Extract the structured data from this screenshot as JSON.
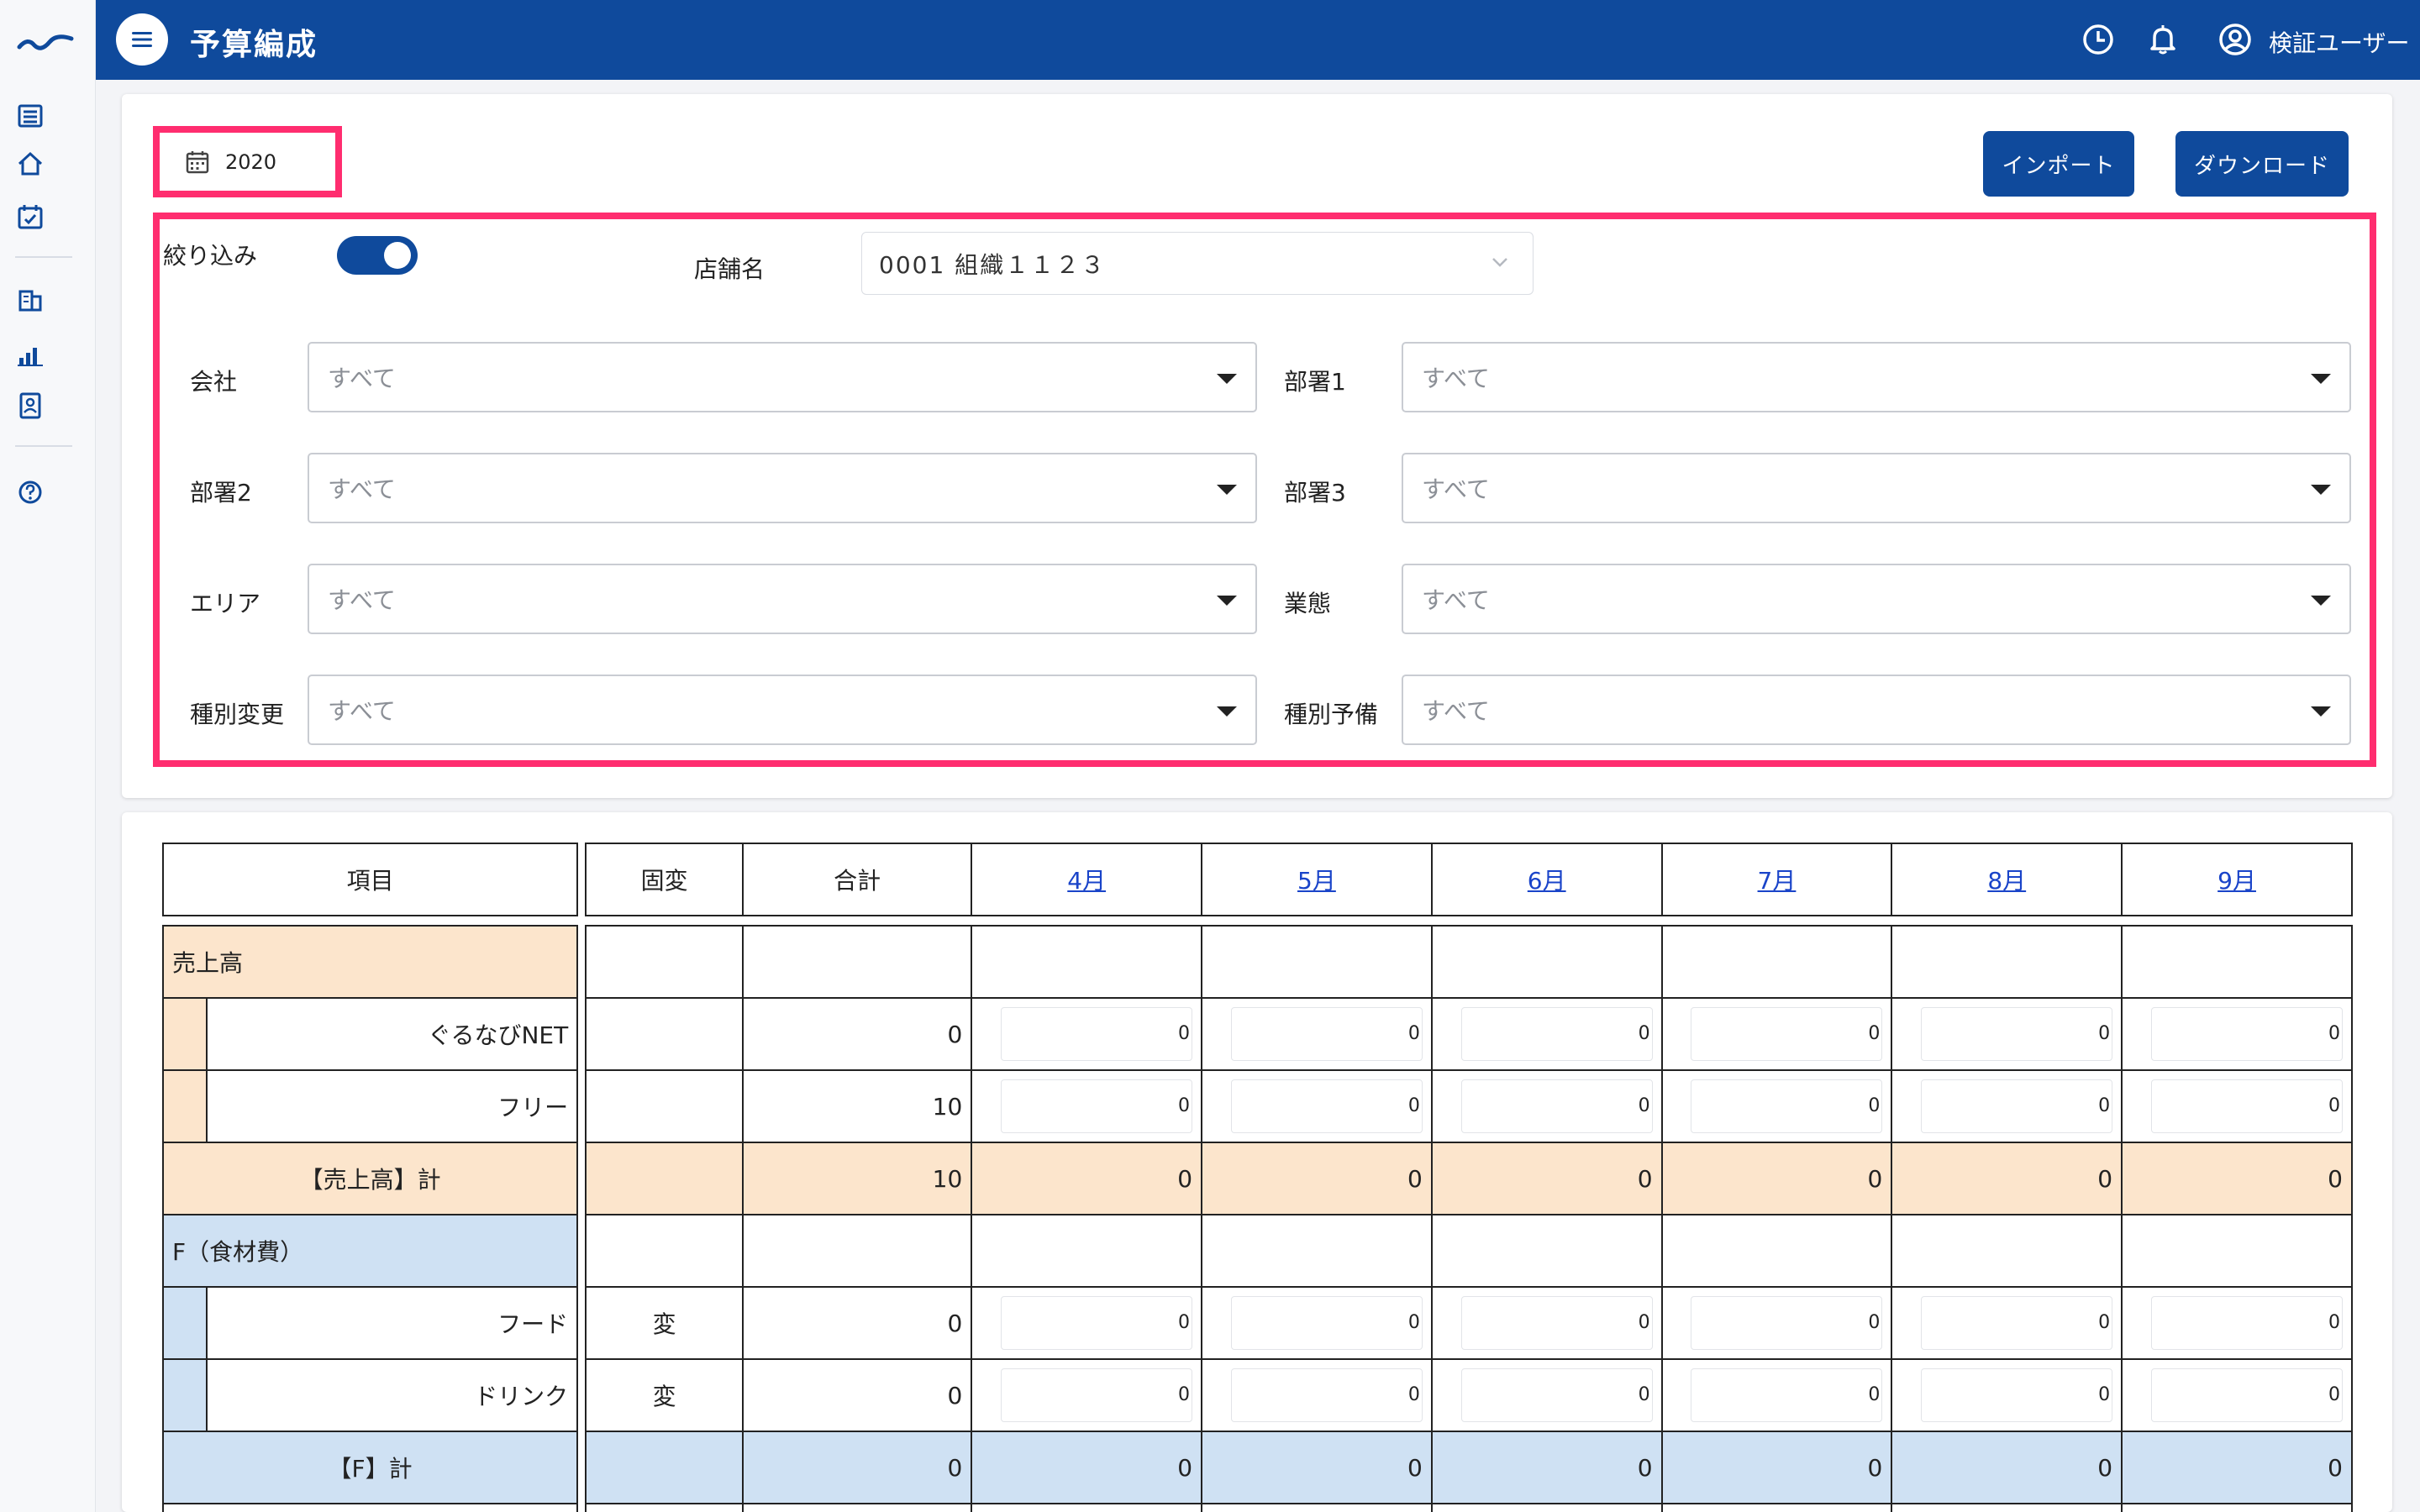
{
  "header": {
    "title": "予算編成",
    "user": "検証ユーザー"
  },
  "toolbar": {
    "year": "2020",
    "import_label": "インポート",
    "download_label": "ダウンロード"
  },
  "filters": {
    "toggle_label": "絞り込み",
    "store_label": "店舗名",
    "store_value": "0001 組織１１２３",
    "fields": [
      {
        "label": "会社",
        "value": "すべて"
      },
      {
        "label": "部署1",
        "value": "すべて"
      },
      {
        "label": "部署2",
        "value": "すべて"
      },
      {
        "label": "部署3",
        "value": "すべて"
      },
      {
        "label": "エリア",
        "value": "すべて"
      },
      {
        "label": "業態",
        "value": "すべて"
      },
      {
        "label": "種別変更",
        "value": "すべて"
      },
      {
        "label": "種別予備",
        "value": "すべて"
      }
    ]
  },
  "table": {
    "headers": {
      "item": "項目",
      "fixed": "固変",
      "total": "合計",
      "months": [
        "4月",
        "5月",
        "6月",
        "7月",
        "8月",
        "9月"
      ]
    },
    "sales": {
      "label": "売上高",
      "rows": [
        {
          "name": "ぐるなびNET",
          "type": "",
          "total": "0",
          "values": [
            "0",
            "0",
            "0",
            "0",
            "0",
            "0"
          ]
        },
        {
          "name": "フリー",
          "type": "",
          "total": "10",
          "values": [
            "0",
            "0",
            "0",
            "0",
            "0",
            "0"
          ]
        }
      ],
      "subtotal": {
        "label": "【売上高】計",
        "total": "10",
        "values": [
          "0",
          "0",
          "0",
          "0",
          "0",
          "0"
        ]
      }
    },
    "food": {
      "label": "F（食材費）",
      "rows": [
        {
          "name": "フード",
          "type": "変",
          "total": "0",
          "values": [
            "0",
            "0",
            "0",
            "0",
            "0",
            "0"
          ]
        },
        {
          "name": "ドリンク",
          "type": "変",
          "total": "0",
          "values": [
            "0",
            "0",
            "0",
            "0",
            "0",
            "0"
          ]
        }
      ],
      "subtotal": {
        "label": "【F】計",
        "total": "0",
        "values": [
          "0",
          "0",
          "0",
          "0",
          "0",
          "0"
        ]
      }
    }
  },
  "colors": {
    "primary": "#0f4a9c",
    "highlight": "#ff2d6f",
    "peach": "#fce5cc",
    "light_blue": "#cfe1f3"
  }
}
